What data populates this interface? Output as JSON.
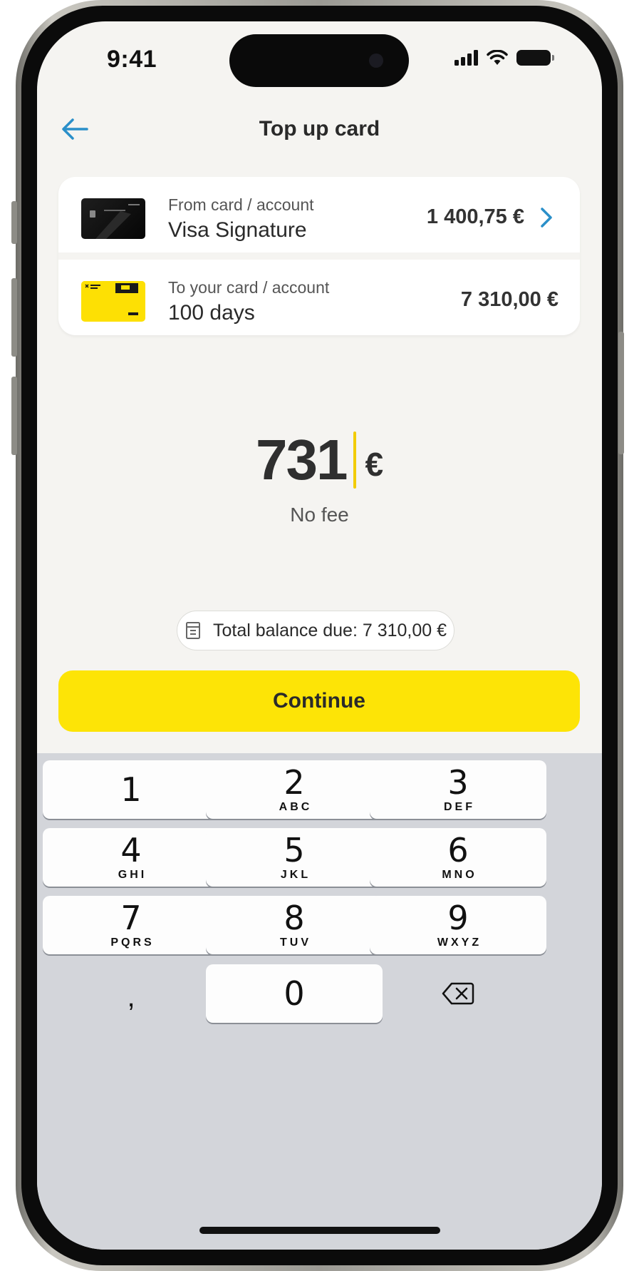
{
  "status_bar": {
    "time": "9:41"
  },
  "header": {
    "title": "Top up card"
  },
  "from_account": {
    "label": "From card / account",
    "name": "Visa Signature",
    "balance": "1 400,75 €"
  },
  "to_account": {
    "label": "To your card / account",
    "name": "100 days",
    "balance": "7 310,00 €"
  },
  "amount": {
    "value": "731",
    "currency": "€",
    "fee_text": "No fee"
  },
  "balance_pill": {
    "text": "Total balance due: 7 310,00 €",
    "icon": "receipt-icon"
  },
  "continue_button": {
    "label": "Continue"
  },
  "keypad": {
    "keys": [
      {
        "digit": "1",
        "letters": ""
      },
      {
        "digit": "2",
        "letters": "ABC"
      },
      {
        "digit": "3",
        "letters": "DEF"
      },
      {
        "digit": "4",
        "letters": "GHI"
      },
      {
        "digit": "5",
        "letters": "JKL"
      },
      {
        "digit": "6",
        "letters": "MNO"
      },
      {
        "digit": "7",
        "letters": "PQRS"
      },
      {
        "digit": "8",
        "letters": "TUV"
      },
      {
        "digit": "9",
        "letters": "WXYZ"
      }
    ],
    "comma": ",",
    "zero": "0"
  },
  "colors": {
    "accent_yellow": "#fde406",
    "link_blue": "#2a8fc9",
    "background": "#f5f4f1",
    "keypad_bg": "#d3d5da"
  }
}
